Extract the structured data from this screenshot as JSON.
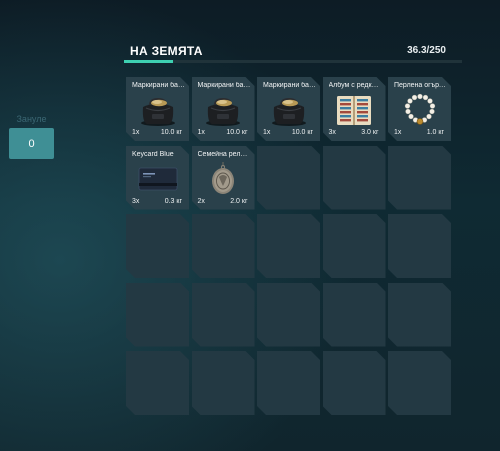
{
  "left_panel": {
    "label": "Зануле",
    "value": "0"
  },
  "header": {
    "title": "НА ЗЕМЯТА",
    "weight_text": "36.3/250",
    "weight_current": 36.3,
    "weight_max": 250
  },
  "colors": {
    "accent": "#3ed0b1",
    "left_box": "#3f8f95",
    "slot": "#243a44"
  },
  "items": [
    {
      "name": "Маркирани банк...",
      "qty": "1x",
      "weight": "10.0 кг",
      "icon": "money-bag-icon"
    },
    {
      "name": "Маркирани банк...",
      "qty": "1x",
      "weight": "10.0 кг",
      "icon": "money-bag-icon"
    },
    {
      "name": "Маркирани банк...",
      "qty": "1x",
      "weight": "10.0 кг",
      "icon": "money-bag-icon"
    },
    {
      "name": "Албум с редки ...",
      "qty": "3x",
      "weight": "3.0 кг",
      "icon": "coin-album-icon"
    },
    {
      "name": "Перлена огърлица",
      "qty": "1x",
      "weight": "1.0 кг",
      "icon": "pearl-necklace-icon"
    },
    {
      "name": "Keycard Blue",
      "qty": "3x",
      "weight": "0.3 кг",
      "icon": "keycard-icon"
    },
    {
      "name": "Семейна реликва",
      "qty": "2x",
      "weight": "2.0 кг",
      "icon": "locket-icon"
    }
  ],
  "grid": {
    "columns": 5,
    "rows": 5
  }
}
